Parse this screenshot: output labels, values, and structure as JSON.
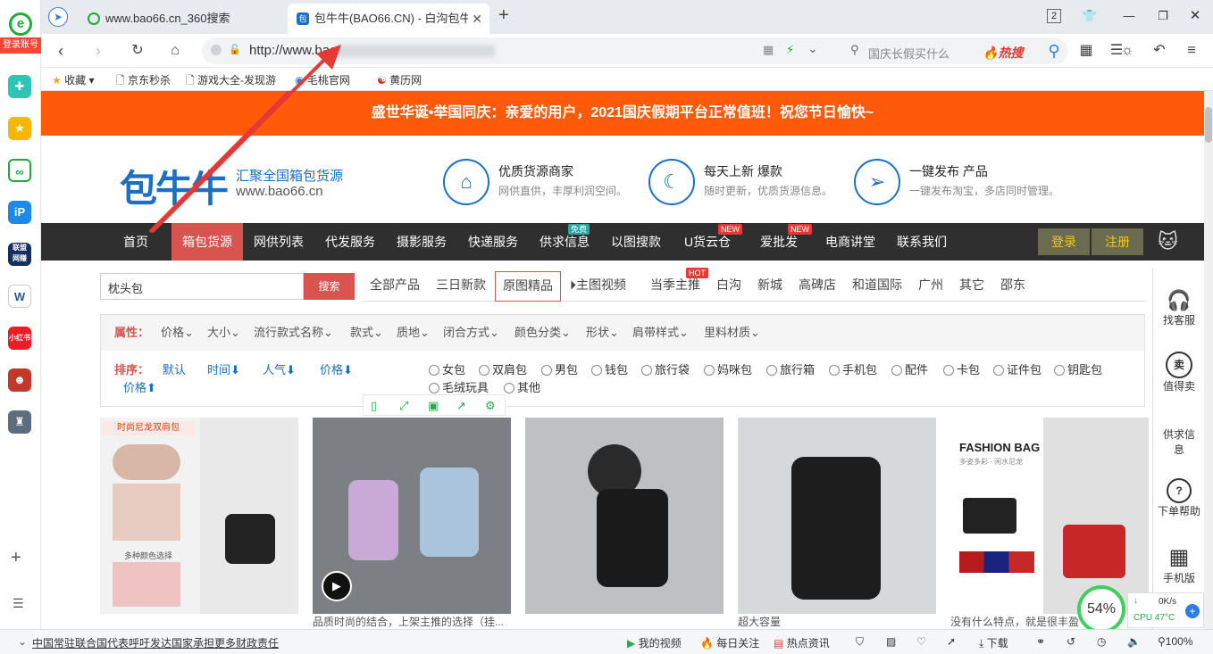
{
  "browser": {
    "login_label": "登录账号",
    "tabs": [
      {
        "title": "www.bao66.cn_360搜索"
      },
      {
        "title": "包牛牛(BAO66.CN) - 白沟包牛"
      }
    ],
    "tab_count": "2",
    "url": "http://www.bao",
    "search_placeholder": "国庆长假买什么",
    "hot_label": "热搜",
    "bookmarks": [
      "收藏",
      "京东秒杀",
      "游戏大全-发现游",
      "毛桃官网",
      "黄历网"
    ],
    "rail_apps": [
      "拼多多",
      "收藏",
      "云盘",
      "iP",
      "联盟网赚",
      "文档",
      "小红书",
      "游戏",
      "游戏2"
    ],
    "colors": {
      "accent": "#ff5a0a",
      "nav_dark": "#2f2f2f",
      "brand_blue": "#1b6fc4",
      "active_red": "#d9534f"
    }
  },
  "page": {
    "banner": "盛世华诞•举国同庆：亲爱的用户，2021国庆假期平台正常值班！祝您节日愉快~",
    "logo": {
      "text": "包牛牛",
      "slogan": "汇聚全国箱包货源",
      "url": "www.bao66.cn"
    },
    "features": [
      {
        "title": "优质货源商家",
        "desc": "网供直供，丰厚利润空间。",
        "icon": "storefront-icon"
      },
      {
        "title": "每天上新 爆款",
        "desc": "随时更新，优质货源信息。",
        "icon": "moon-icon"
      },
      {
        "title": "一键发布 产品",
        "desc": "一键发布淘宝，多店同时管理。",
        "icon": "paper-plane-icon"
      }
    ],
    "nav": {
      "items": [
        "首页",
        "箱包货源",
        "网供列表",
        "代发服务",
        "摄影服务",
        "快递服务",
        "供求信息",
        "以图搜款",
        "U货云仓",
        "爱批发",
        "电商讲堂",
        "联系我们"
      ],
      "badges": {
        "free": "免费",
        "new": "NEW",
        "hot": "HOT"
      },
      "login": "登录",
      "register": "注册"
    },
    "search": {
      "value": "枕头包",
      "button": "搜索"
    },
    "filters": [
      "全部产品",
      "三日新款",
      "原图精品",
      "主图视频",
      "当季主推",
      "白沟",
      "新城",
      "高碑店",
      "和道国际",
      "广州",
      "其它",
      "邵东"
    ],
    "attributes": {
      "label": "属性：",
      "items": [
        "价格",
        "大小",
        "流行款式名称",
        "款式",
        "质地",
        "闭合方式",
        "颜色分类",
        "形状",
        "肩带样式",
        "里料材质"
      ]
    },
    "sort": {
      "label": "排序：",
      "items": [
        "默认",
        "时间",
        "人气",
        "价格",
        "价格"
      ]
    },
    "categories": [
      "女包",
      "双肩包",
      "男包",
      "钱包",
      "旅行袋",
      "妈咪包",
      "旅行箱",
      "手机包",
      "配件",
      "卡包",
      "证件包",
      "钥匙包",
      "毛绒玩具",
      "其他"
    ],
    "products": [
      {
        "caption": "",
        "promo": "时尚尼龙双肩包",
        "promo2": "多种颜色选择"
      },
      {
        "caption": "品质时尚的结合，上架主推的选择（挂..."
      },
      {
        "caption": ""
      },
      {
        "caption": "超大容量"
      },
      {
        "caption": "没有什么特点，就是很丰盈",
        "brand_text": "FASHION BAG",
        "brand_sub": "多姿多彩 · 闲水尼龙"
      }
    ],
    "float_bar": [
      "找客服",
      "值得卖",
      "供求信息",
      "下单帮助",
      "手机版"
    ]
  },
  "status_bar": {
    "news": "中国常驻联合国代表呼吁发达国家承担更多财政责任",
    "items": [
      "我的视频",
      "每日关注",
      "热点资讯",
      "下载"
    ],
    "cpu": "54%",
    "speed": "0K/s",
    "cpu_temp": "CPU 47°C",
    "zoom": "100%"
  }
}
